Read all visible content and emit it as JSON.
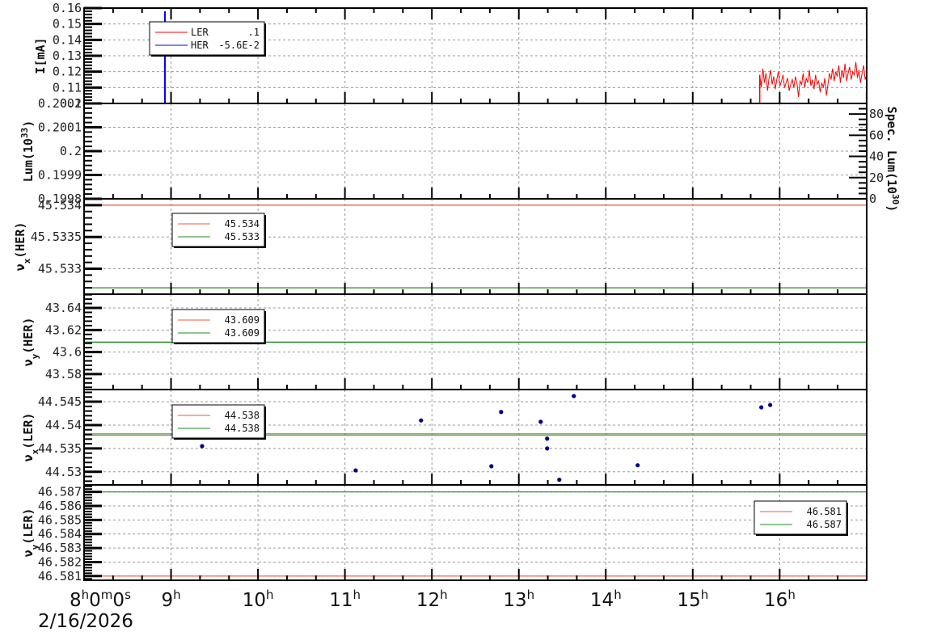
{
  "chart_data": {
    "type": "line",
    "title": "",
    "xaxis": {
      "unit": "hours",
      "xlim": [
        8,
        17
      ],
      "origin_label": {
        "h": "8",
        "h_unit": "h",
        "m": "0",
        "m_unit": "m",
        "s": "0",
        "s_unit": "s"
      },
      "date_label": "2/16/2026",
      "hour_labels": [
        {
          "value": 9,
          "num": "9",
          "unit": "h"
        },
        {
          "value": 10,
          "num": "10",
          "unit": "h"
        },
        {
          "value": 11,
          "num": "11",
          "unit": "h"
        },
        {
          "value": 12,
          "num": "12",
          "unit": "h"
        },
        {
          "value": 13,
          "num": "13",
          "unit": "h"
        },
        {
          "value": 14,
          "num": "14",
          "unit": "h"
        },
        {
          "value": 15,
          "num": "15",
          "unit": "h"
        },
        {
          "value": 16,
          "num": "16",
          "unit": "h"
        }
      ],
      "minor_step": 0.3333,
      "grid": true
    },
    "panels": [
      {
        "id": "current",
        "ylabel": [
          {
            "t": "I[mA]"
          }
        ],
        "ylim": [
          0.1,
          0.16
        ],
        "yticks": [
          {
            "v": 0.1,
            "label": "0.1"
          },
          {
            "v": 0.11,
            "label": "0.11"
          },
          {
            "v": 0.12,
            "label": "0.12"
          },
          {
            "v": 0.13,
            "label": "0.13"
          },
          {
            "v": 0.14,
            "label": "0.14"
          },
          {
            "v": 0.15,
            "label": "0.15"
          },
          {
            "v": 0.16,
            "label": "0.16"
          }
        ],
        "series": [
          {
            "name": "LER",
            "color": "#ff0000",
            "type": "line",
            "x": [
              9.73,
              15.77,
              15.77
            ],
            "y": [
              0.1,
              0.1,
              0.118
            ]
          },
          {
            "name": "LER",
            "color": "#ff0000",
            "type": "line-even",
            "x_start": 15.77,
            "x_end": 17.0,
            "y": [
              0.118,
              0.11,
              0.122,
              0.113,
              0.119,
              0.108,
              0.116,
              0.121,
              0.112,
              0.117,
              0.109,
              0.115,
              0.12,
              0.111,
              0.114,
              0.118,
              0.11,
              0.113,
              0.116,
              0.108,
              0.112,
              0.115,
              0.11,
              0.117,
              0.113,
              0.104,
              0.114,
              0.112,
              0.119,
              0.11,
              0.116,
              0.113,
              0.121,
              0.111,
              0.115,
              0.109,
              0.118,
              0.112,
              0.114,
              0.107,
              0.113,
              0.11,
              0.116,
              0.105,
              0.112,
              0.119,
              0.115,
              0.122,
              0.114,
              0.12,
              0.117,
              0.124,
              0.113,
              0.121,
              0.116,
              0.125,
              0.114,
              0.119,
              0.123,
              0.115,
              0.12,
              0.118,
              0.126,
              0.116,
              0.121,
              0.113,
              0.119,
              0.124,
              0.115,
              0.118
            ]
          },
          {
            "name": "HER",
            "color": "#0000ff",
            "type": "line",
            "x": [
              8.93,
              8.93
            ],
            "y": [
              0.1,
              0.158
            ]
          }
        ],
        "legend": {
          "placement": "top-left",
          "entries": [
            {
              "label": "LER",
              "value": ".1",
              "color": "#ff0000"
            },
            {
              "label": "HER",
              "value": "-5.6E-2",
              "color": "#0000ff"
            }
          ]
        }
      },
      {
        "id": "luminosity",
        "ylabel": [
          {
            "t": "Lum(10"
          },
          {
            "t": "33",
            "sup": true
          },
          {
            "t": ")"
          }
        ],
        "ylim": [
          0.1998,
          0.2002
        ],
        "yticks": [
          {
            "v": 0.1998,
            "label": "0.1998"
          },
          {
            "v": 0.1999,
            "label": "0.1999"
          },
          {
            "v": 0.2,
            "label": "0.2"
          },
          {
            "v": 0.2001,
            "label": "0.2001"
          },
          {
            "v": 0.2002,
            "label": "0.2002"
          }
        ],
        "y2label": [
          {
            "t": "Spec. Lum(10"
          },
          {
            "t": "30",
            "sup": true
          },
          {
            "t": ")"
          }
        ],
        "y2lim": [
          0,
          90
        ],
        "y2ticks": [
          {
            "v": 0,
            "label": "0"
          },
          {
            "v": 20,
            "label": "20"
          },
          {
            "v": 40,
            "label": "40"
          },
          {
            "v": 60,
            "label": "60"
          },
          {
            "v": 80,
            "label": "80"
          }
        ],
        "series": []
      },
      {
        "id": "nux-her",
        "ylabel": [
          {
            "t": "ν"
          },
          {
            "t": "x",
            "sub": true
          },
          {
            "t": "(HER)"
          }
        ],
        "ylim": [
          45.5326,
          45.5341
        ],
        "yticks": [
          {
            "v": 45.533,
            "label": "45.533"
          },
          {
            "v": 45.5335,
            "label": "45.5335"
          },
          {
            "v": 45.534,
            "label": "45.534"
          }
        ],
        "series": [
          {
            "name": "set-1",
            "color": "#f05a3c",
            "type": "hline",
            "y": 45.534
          },
          {
            "name": "set-2",
            "color": "#228b22",
            "type": "hline",
            "y": 45.5327
          }
        ],
        "legend": {
          "placement": "top-left",
          "entries": [
            {
              "label": "",
              "value": "45.534",
              "color": "#f05a3c"
            },
            {
              "label": "",
              "value": "45.533",
              "color": "#228b22"
            }
          ]
        }
      },
      {
        "id": "nuy-her",
        "ylabel": [
          {
            "t": "ν"
          },
          {
            "t": "y",
            "sub": true
          },
          {
            "t": "(HER)"
          }
        ],
        "ylim": [
          43.566,
          43.6525
        ],
        "yticks": [
          {
            "v": 43.58,
            "label": "43.58"
          },
          {
            "v": 43.6,
            "label": "43.6"
          },
          {
            "v": 43.62,
            "label": "43.62"
          },
          {
            "v": 43.64,
            "label": "43.64"
          }
        ],
        "series": [
          {
            "name": "set-1",
            "color": "#f05a3c",
            "type": "hline",
            "y": 43.609
          },
          {
            "name": "set-2",
            "color": "#228b22",
            "type": "hline",
            "y": 43.609
          }
        ],
        "legend": {
          "placement": "top-left",
          "entries": [
            {
              "label": "",
              "value": "43.609",
              "color": "#f05a3c"
            },
            {
              "label": "",
              "value": "43.609",
              "color": "#228b22"
            }
          ]
        }
      },
      {
        "id": "nux-ler",
        "ylabel": [
          {
            "t": "ν"
          },
          {
            "t": "x",
            "sub": true
          },
          {
            "t": "(LER)"
          }
        ],
        "ylim": [
          44.5272,
          44.5476
        ],
        "yticks": [
          {
            "v": 44.53,
            "label": "44.53"
          },
          {
            "v": 44.535,
            "label": "44.535"
          },
          {
            "v": 44.54,
            "label": "44.54"
          },
          {
            "v": 44.545,
            "label": "44.545"
          }
        ],
        "series": [
          {
            "name": "set-1",
            "color": "#f05a3c",
            "type": "hline",
            "y": 44.5378
          },
          {
            "name": "set-2",
            "color": "#228b22",
            "type": "hline",
            "y": 44.5381
          },
          {
            "name": "measurements",
            "color": "#00008b",
            "type": "points",
            "x": [
              9.357,
              9.626,
              11.123,
              11.875,
              12.684,
              12.796,
              13.251,
              13.325,
              13.325,
              13.465,
              13.632,
              14.366,
              15.788,
              15.89
            ],
            "y": [
              44.5355,
              44.539,
              44.5303,
              44.541,
              44.5312,
              44.5428,
              44.5407,
              44.5371,
              44.535,
              44.5283,
              44.5462,
              44.5314,
              44.5438,
              44.5443
            ]
          }
        ],
        "legend": {
          "placement": "top-left",
          "entries": [
            {
              "label": "",
              "value": "44.538",
              "color": "#f05a3c"
            },
            {
              "label": "",
              "value": "44.538",
              "color": "#228b22"
            }
          ]
        }
      },
      {
        "id": "nuy-ler",
        "ylabel": [
          {
            "t": "ν"
          },
          {
            "t": "y",
            "sub": true
          },
          {
            "t": "(LER)"
          }
        ],
        "ylim": [
          46.5807,
          46.5875
        ],
        "yticks": [
          {
            "v": 46.581,
            "label": "46.581"
          },
          {
            "v": 46.582,
            "label": "46.582"
          },
          {
            "v": 46.583,
            "label": "46.583"
          },
          {
            "v": 46.584,
            "label": "46.584"
          },
          {
            "v": 46.585,
            "label": "46.585"
          },
          {
            "v": 46.586,
            "label": "46.586"
          },
          {
            "v": 46.587,
            "label": "46.587"
          }
        ],
        "series": [
          {
            "name": "set-1",
            "color": "#f05a3c",
            "type": "hline",
            "y": 46.581
          },
          {
            "name": "set-2",
            "color": "#228b22",
            "type": "hline",
            "y": 46.587
          }
        ],
        "legend": {
          "placement": "top-right",
          "entries": [
            {
              "label": "",
              "value": "46.581",
              "color": "#f05a3c"
            },
            {
              "label": "",
              "value": "46.587",
              "color": "#228b22"
            }
          ]
        }
      }
    ]
  }
}
